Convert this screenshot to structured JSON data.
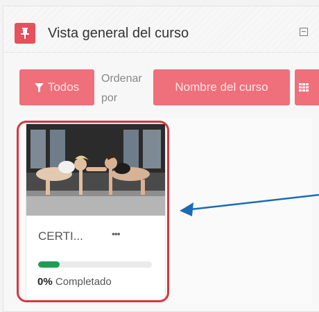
{
  "block": {
    "title": "Vista general del curso",
    "pin_icon": "pin-icon",
    "collapse_icon": "collapse-icon"
  },
  "toolbar": {
    "filter_label": "Todos",
    "filter_icon": "filter-icon",
    "sort_label": "Ordenar por",
    "sort_value": "Nombre del curso",
    "view_icon": "grid-icon"
  },
  "course": {
    "name": "CERTI...",
    "more_menu": "•••",
    "progress_percent": 0,
    "progress_value": "0%",
    "progress_label": "Completado",
    "image_alt": "two-women-plank-handshake-photo"
  },
  "colors": {
    "accent": "#e5515c",
    "button": "#ef707a",
    "progress": "#1e9d57",
    "highlight": "#d9343d",
    "arrow": "#1a6bb6"
  }
}
